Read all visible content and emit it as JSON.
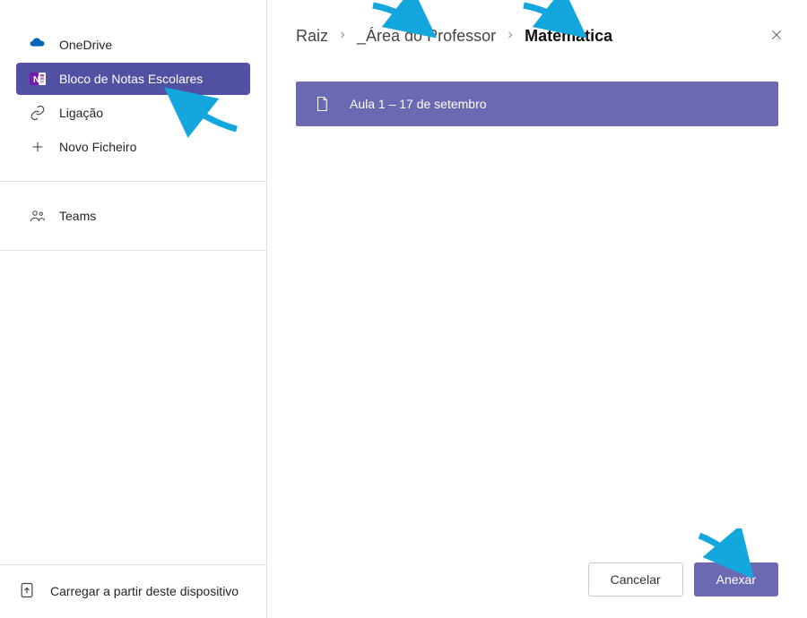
{
  "sidebar": {
    "items": [
      {
        "label": "OneDrive"
      },
      {
        "label": "Bloco de Notas Escolares"
      },
      {
        "label": "Ligação"
      },
      {
        "label": "Novo Ficheiro"
      }
    ],
    "teams_label": "Teams",
    "upload_label": "Carregar a partir deste dispositivo"
  },
  "breadcrumb": {
    "items": [
      "Raiz",
      "_Área do Professor",
      "Matemática"
    ]
  },
  "files": {
    "items": [
      {
        "name": "Aula 1 – 17 de setembro"
      }
    ]
  },
  "footer": {
    "cancel_label": "Cancelar",
    "attach_label": "Anexar"
  },
  "colors": {
    "accent": "#6b69b1",
    "accent_dark": "#5250a3",
    "arrow": "#14a7de"
  }
}
